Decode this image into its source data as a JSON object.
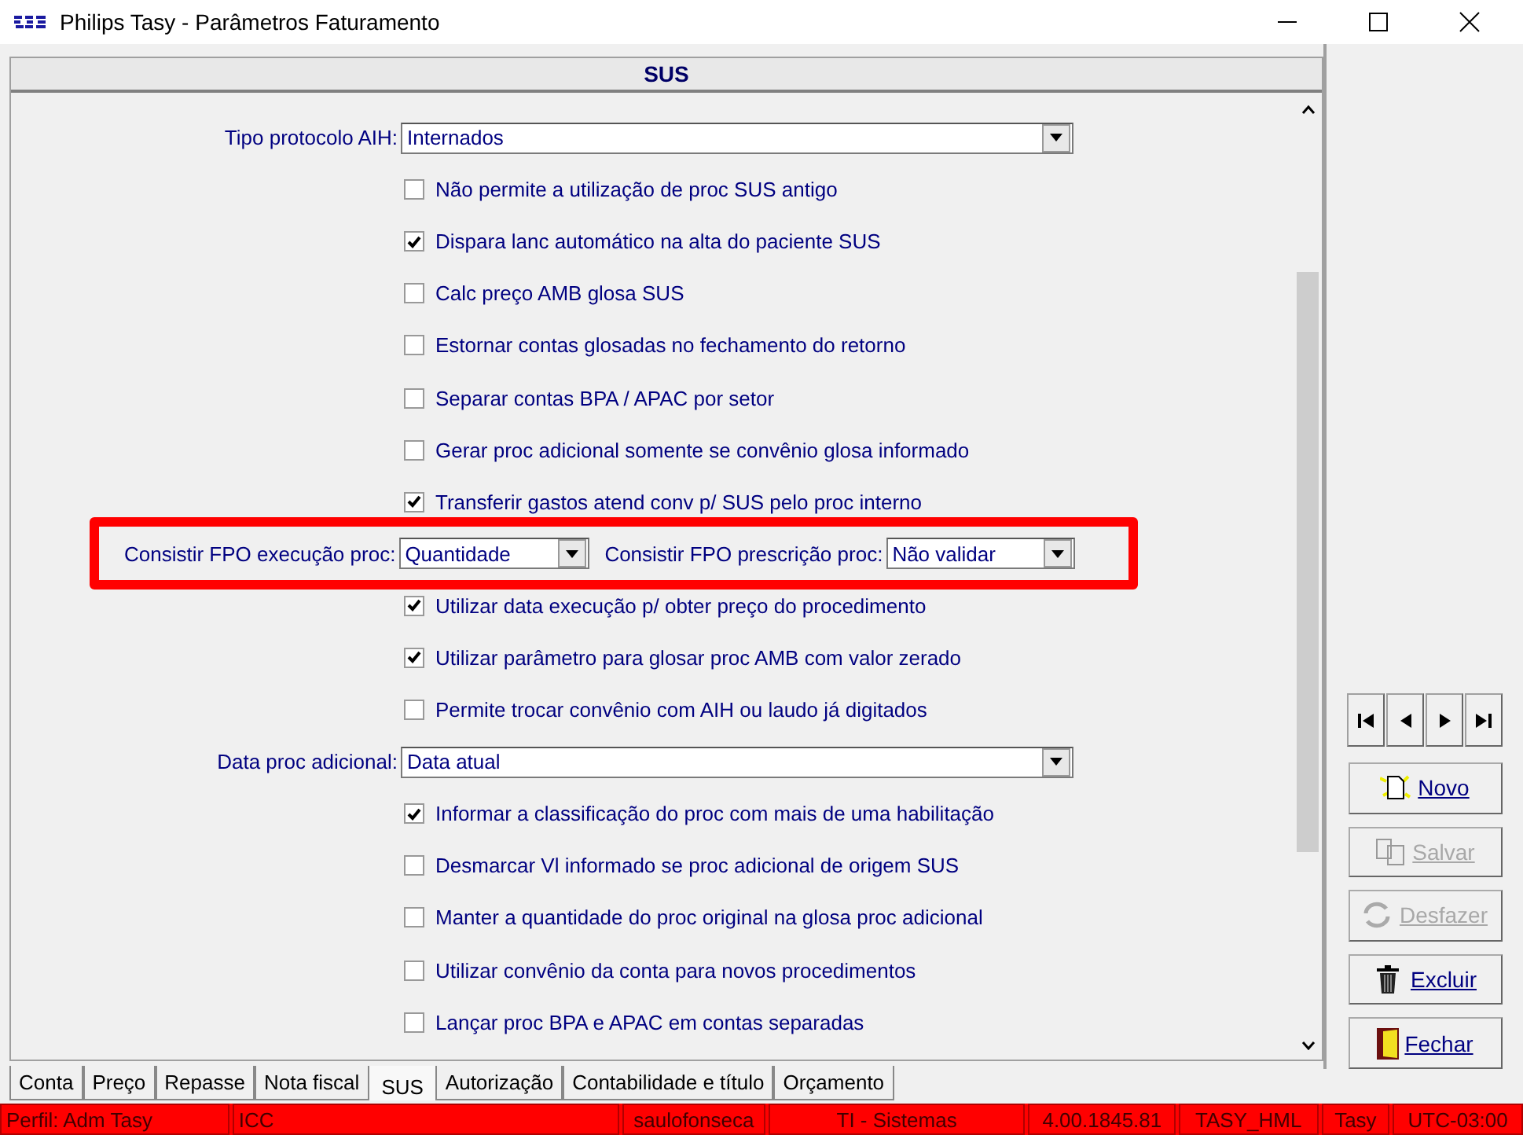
{
  "window": {
    "title": "Philips Tasy - Parâmetros Faturamento"
  },
  "panel": {
    "title": "SUS"
  },
  "rows": [
    {
      "kind": "select",
      "label": "Tipo protocolo AIH:",
      "value": "Internados"
    },
    {
      "kind": "checkbox",
      "label": "Não permite a utilização de proc SUS antigo",
      "checked": false
    },
    {
      "kind": "checkbox",
      "label": "Dispara lanc automático na alta do paciente SUS",
      "checked": true
    },
    {
      "kind": "checkbox",
      "label": "Calc preço AMB glosa SUS",
      "checked": false
    },
    {
      "kind": "checkbox",
      "label": "Estornar contas glosadas no fechamento do retorno",
      "checked": false
    },
    {
      "kind": "checkbox",
      "label": "Separar contas BPA / APAC por setor",
      "checked": false
    },
    {
      "kind": "checkbox",
      "label": "Gerar proc adicional somente se convênio glosa informado",
      "checked": false
    },
    {
      "kind": "checkbox",
      "label": "Transferir gastos atend conv p/ SUS pelo proc interno",
      "checked": true
    },
    {
      "kind": "pair",
      "highlighted": true,
      "label": "Consistir FPO execução proc:",
      "value": "Quantidade",
      "label_2": "Consistir FPO prescrição proc:",
      "value_2": "Não validar"
    },
    {
      "kind": "checkbox",
      "label": "Utilizar data execução p/ obter preço do procedimento",
      "checked": true
    },
    {
      "kind": "checkbox",
      "label": "Utilizar parâmetro para glosar proc  AMB com valor zerado",
      "checked": true
    },
    {
      "kind": "checkbox",
      "label": "Permite trocar convênio com AIH ou laudo já digitados",
      "checked": false
    },
    {
      "kind": "select",
      "label": "Data proc adicional:",
      "value": "Data atual"
    },
    {
      "kind": "checkbox",
      "label": "Informar a classificação do proc com mais de uma habilitação",
      "checked": true
    },
    {
      "kind": "checkbox",
      "label": "Desmarcar Vl informado se proc adicional de origem SUS",
      "checked": false
    },
    {
      "kind": "checkbox",
      "label": "Manter a quantidade do proc original na glosa proc adicional",
      "checked": false
    },
    {
      "kind": "checkbox",
      "label": "Utilizar convênio da conta para novos procedimentos",
      "checked": false
    },
    {
      "kind": "checkbox",
      "label": "Lançar proc BPA e APAC em contas separadas",
      "checked": false
    }
  ],
  "tabs": [
    {
      "label": "Conta",
      "selected": false
    },
    {
      "label": "Preço",
      "selected": false
    },
    {
      "label": "Repasse",
      "selected": false
    },
    {
      "label": "Nota fiscal",
      "selected": false
    },
    {
      "label": "SUS",
      "selected": true
    },
    {
      "label": "Autorização",
      "selected": false
    },
    {
      "label": "Contabilidade e título",
      "selected": false
    },
    {
      "label": "Orçamento",
      "selected": false
    }
  ],
  "actions": [
    {
      "kind": "new",
      "label": "Novo",
      "disabled": false
    },
    {
      "kind": "save",
      "label": "Salvar",
      "disabled": true
    },
    {
      "kind": "undo",
      "label": "Desfazer",
      "disabled": true
    },
    {
      "kind": "delete",
      "label": "Excluir",
      "disabled": false
    },
    {
      "kind": "close",
      "label": "Fechar",
      "disabled": false
    }
  ],
  "status_bar": [
    "Perfil: Adm Tasy",
    "ICC",
    "saulofonseca",
    "TI - Sistemas",
    "4.00.1845.81",
    "TASY_HML",
    "Tasy",
    "UTC-03:00"
  ]
}
